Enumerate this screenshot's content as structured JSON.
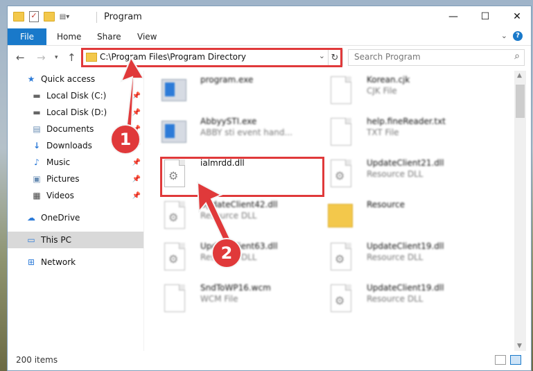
{
  "window": {
    "title": "Program",
    "controls": {
      "minimize": "—",
      "maximize": "☐",
      "close": "✕"
    }
  },
  "ribbon": {
    "tabs": [
      "File",
      "Home",
      "Share",
      "View"
    ],
    "help": "?"
  },
  "nav": {
    "address": "C:\\Program Files\\Program Directory",
    "search_placeholder": "Search Program"
  },
  "sidebar": {
    "items": [
      {
        "label": "Quick access",
        "icon": "star-icon",
        "pinned": false
      },
      {
        "label": "Local Disk (C:)",
        "icon": "drive-icon",
        "pinned": true
      },
      {
        "label": "Local Disk (D:)",
        "icon": "drive-icon",
        "pinned": true
      },
      {
        "label": "Documents",
        "icon": "documents-icon",
        "pinned": true
      },
      {
        "label": "Downloads",
        "icon": "download-icon",
        "pinned": true
      },
      {
        "label": "Music",
        "icon": "music-icon",
        "pinned": true
      },
      {
        "label": "Pictures",
        "icon": "pictures-icon",
        "pinned": true
      },
      {
        "label": "Videos",
        "icon": "videos-icon",
        "pinned": true
      },
      {
        "label": "OneDrive",
        "icon": "cloud-icon",
        "pinned": false
      },
      {
        "label": "This PC",
        "icon": "pc-icon",
        "pinned": false
      },
      {
        "label": "Network",
        "icon": "network-icon",
        "pinned": false
      }
    ]
  },
  "files": [
    {
      "name": "program.exe",
      "type": "",
      "icon": "exe"
    },
    {
      "name": "Korean.cjk",
      "type": "CJK File",
      "icon": "doc"
    },
    {
      "name": "AbbyySTI.exe",
      "type": "ABBY sti event hand...",
      "icon": "exe"
    },
    {
      "name": "help.fineReader.txt",
      "type": "TXT File",
      "icon": "doc"
    },
    {
      "name": "ialmrdd.dll",
      "type": "",
      "icon": "dll"
    },
    {
      "name": "UpdateClient21.dll",
      "type": "Resource DLL",
      "icon": "dll"
    },
    {
      "name": "UpdateClient42.dll",
      "type": "Resource DLL",
      "icon": "dll"
    },
    {
      "name": "Resource",
      "type": "",
      "icon": "folder"
    },
    {
      "name": "UpdateClient63.dll",
      "type": "Resource DLL",
      "icon": "dll"
    },
    {
      "name": "UpdateClient19.dll",
      "type": "Resource DLL",
      "icon": "dll"
    },
    {
      "name": "SndToWP16.wcm",
      "type": "WCM File",
      "icon": "doc"
    },
    {
      "name": "UpdateClient19.dll",
      "type": "Resource DLL",
      "icon": "dll"
    }
  ],
  "status": {
    "count": "200 items"
  },
  "annotations": {
    "step1": "1",
    "step2": "2",
    "color": "#e0393a"
  },
  "colors": {
    "accent": "#1979ca",
    "highlight": "#e0393a"
  }
}
